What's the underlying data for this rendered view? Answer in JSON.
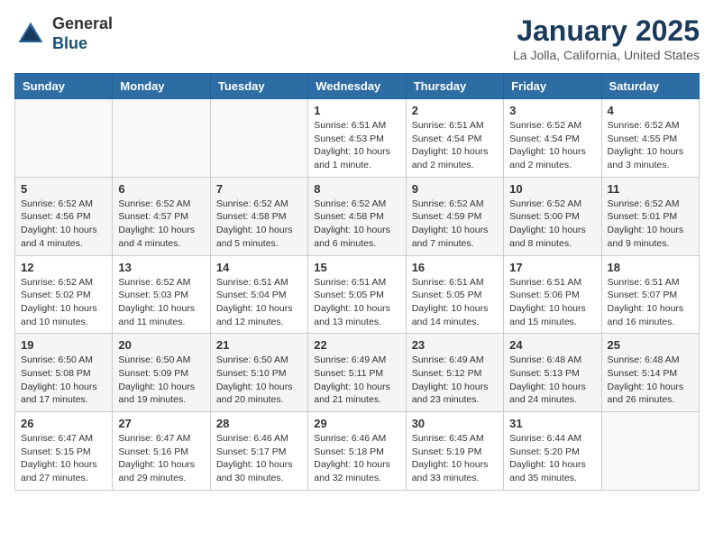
{
  "header": {
    "logo_general": "General",
    "logo_blue": "Blue",
    "title": "January 2025",
    "location": "La Jolla, California, United States"
  },
  "weekdays": [
    "Sunday",
    "Monday",
    "Tuesday",
    "Wednesday",
    "Thursday",
    "Friday",
    "Saturday"
  ],
  "weeks": [
    [
      {
        "day": "",
        "info": ""
      },
      {
        "day": "",
        "info": ""
      },
      {
        "day": "",
        "info": ""
      },
      {
        "day": "1",
        "info": "Sunrise: 6:51 AM\nSunset: 4:53 PM\nDaylight: 10 hours\nand 1 minute."
      },
      {
        "day": "2",
        "info": "Sunrise: 6:51 AM\nSunset: 4:54 PM\nDaylight: 10 hours\nand 2 minutes."
      },
      {
        "day": "3",
        "info": "Sunrise: 6:52 AM\nSunset: 4:54 PM\nDaylight: 10 hours\nand 2 minutes."
      },
      {
        "day": "4",
        "info": "Sunrise: 6:52 AM\nSunset: 4:55 PM\nDaylight: 10 hours\nand 3 minutes."
      }
    ],
    [
      {
        "day": "5",
        "info": "Sunrise: 6:52 AM\nSunset: 4:56 PM\nDaylight: 10 hours\nand 4 minutes."
      },
      {
        "day": "6",
        "info": "Sunrise: 6:52 AM\nSunset: 4:57 PM\nDaylight: 10 hours\nand 4 minutes."
      },
      {
        "day": "7",
        "info": "Sunrise: 6:52 AM\nSunset: 4:58 PM\nDaylight: 10 hours\nand 5 minutes."
      },
      {
        "day": "8",
        "info": "Sunrise: 6:52 AM\nSunset: 4:58 PM\nDaylight: 10 hours\nand 6 minutes."
      },
      {
        "day": "9",
        "info": "Sunrise: 6:52 AM\nSunset: 4:59 PM\nDaylight: 10 hours\nand 7 minutes."
      },
      {
        "day": "10",
        "info": "Sunrise: 6:52 AM\nSunset: 5:00 PM\nDaylight: 10 hours\nand 8 minutes."
      },
      {
        "day": "11",
        "info": "Sunrise: 6:52 AM\nSunset: 5:01 PM\nDaylight: 10 hours\nand 9 minutes."
      }
    ],
    [
      {
        "day": "12",
        "info": "Sunrise: 6:52 AM\nSunset: 5:02 PM\nDaylight: 10 hours\nand 10 minutes."
      },
      {
        "day": "13",
        "info": "Sunrise: 6:52 AM\nSunset: 5:03 PM\nDaylight: 10 hours\nand 11 minutes."
      },
      {
        "day": "14",
        "info": "Sunrise: 6:51 AM\nSunset: 5:04 PM\nDaylight: 10 hours\nand 12 minutes."
      },
      {
        "day": "15",
        "info": "Sunrise: 6:51 AM\nSunset: 5:05 PM\nDaylight: 10 hours\nand 13 minutes."
      },
      {
        "day": "16",
        "info": "Sunrise: 6:51 AM\nSunset: 5:05 PM\nDaylight: 10 hours\nand 14 minutes."
      },
      {
        "day": "17",
        "info": "Sunrise: 6:51 AM\nSunset: 5:06 PM\nDaylight: 10 hours\nand 15 minutes."
      },
      {
        "day": "18",
        "info": "Sunrise: 6:51 AM\nSunset: 5:07 PM\nDaylight: 10 hours\nand 16 minutes."
      }
    ],
    [
      {
        "day": "19",
        "info": "Sunrise: 6:50 AM\nSunset: 5:08 PM\nDaylight: 10 hours\nand 17 minutes."
      },
      {
        "day": "20",
        "info": "Sunrise: 6:50 AM\nSunset: 5:09 PM\nDaylight: 10 hours\nand 19 minutes."
      },
      {
        "day": "21",
        "info": "Sunrise: 6:50 AM\nSunset: 5:10 PM\nDaylight: 10 hours\nand 20 minutes."
      },
      {
        "day": "22",
        "info": "Sunrise: 6:49 AM\nSunset: 5:11 PM\nDaylight: 10 hours\nand 21 minutes."
      },
      {
        "day": "23",
        "info": "Sunrise: 6:49 AM\nSunset: 5:12 PM\nDaylight: 10 hours\nand 23 minutes."
      },
      {
        "day": "24",
        "info": "Sunrise: 6:48 AM\nSunset: 5:13 PM\nDaylight: 10 hours\nand 24 minutes."
      },
      {
        "day": "25",
        "info": "Sunrise: 6:48 AM\nSunset: 5:14 PM\nDaylight: 10 hours\nand 26 minutes."
      }
    ],
    [
      {
        "day": "26",
        "info": "Sunrise: 6:47 AM\nSunset: 5:15 PM\nDaylight: 10 hours\nand 27 minutes."
      },
      {
        "day": "27",
        "info": "Sunrise: 6:47 AM\nSunset: 5:16 PM\nDaylight: 10 hours\nand 29 minutes."
      },
      {
        "day": "28",
        "info": "Sunrise: 6:46 AM\nSunset: 5:17 PM\nDaylight: 10 hours\nand 30 minutes."
      },
      {
        "day": "29",
        "info": "Sunrise: 6:46 AM\nSunset: 5:18 PM\nDaylight: 10 hours\nand 32 minutes."
      },
      {
        "day": "30",
        "info": "Sunrise: 6:45 AM\nSunset: 5:19 PM\nDaylight: 10 hours\nand 33 minutes."
      },
      {
        "day": "31",
        "info": "Sunrise: 6:44 AM\nSunset: 5:20 PM\nDaylight: 10 hours\nand 35 minutes."
      },
      {
        "day": "",
        "info": ""
      }
    ]
  ]
}
